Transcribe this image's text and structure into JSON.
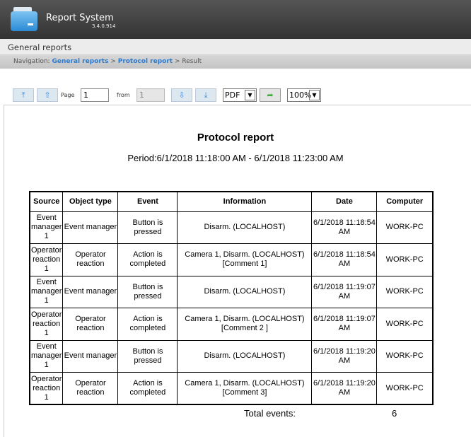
{
  "app": {
    "title": "Report System",
    "version": "3.4.0.914"
  },
  "section": "General reports",
  "nav": {
    "label": "Navigation:",
    "crumbs": [
      "General reports",
      "Protocol report"
    ],
    "current": "Result",
    "sep": " > "
  },
  "toolbar": {
    "page_label": "Page",
    "page_value": "1",
    "from_label": "from",
    "from_value": "1",
    "format": "PDF",
    "zoom": "100%"
  },
  "report": {
    "title": "Protocol report",
    "period": "Period:6/1/2018 11:18:00 AM - 6/1/2018 11:23:00 AM",
    "columns": [
      "Source",
      "Object type",
      "Event",
      "Information",
      "Date",
      "Computer"
    ],
    "rows": [
      [
        "Event manager 1",
        "Event manager",
        "Button is pressed",
        "Disarm. (LOCALHOST)",
        "6/1/2018 11:18:54 AM",
        "WORK-PC"
      ],
      [
        "Operator reaction 1",
        "Operator reaction",
        "Action is completed",
        "Camera 1, Disarm. (LOCALHOST) [Comment 1]",
        "6/1/2018 11:18:54 AM",
        "WORK-PC"
      ],
      [
        "Event manager 1",
        "Event manager",
        "Button is pressed",
        "Disarm. (LOCALHOST)",
        "6/1/2018 11:19:07 AM",
        "WORK-PC"
      ],
      [
        "Operator reaction 1",
        "Operator reaction",
        "Action is completed",
        "Camera 1, Disarm. (LOCALHOST) [Comment 2 ]",
        "6/1/2018 11:19:07 AM",
        "WORK-PC"
      ],
      [
        "Event manager 1",
        "Event manager",
        "Button is pressed",
        "Disarm. (LOCALHOST)",
        "6/1/2018 11:19:20 AM",
        "WORK-PC"
      ],
      [
        "Operator reaction 1",
        "Operator reaction",
        "Action is completed",
        "Camera 1, Disarm. (LOCALHOST) [Comment 3]",
        "6/1/2018 11:19:20 AM",
        "WORK-PC"
      ]
    ],
    "total_label": "Total events:",
    "total_value": "6"
  }
}
